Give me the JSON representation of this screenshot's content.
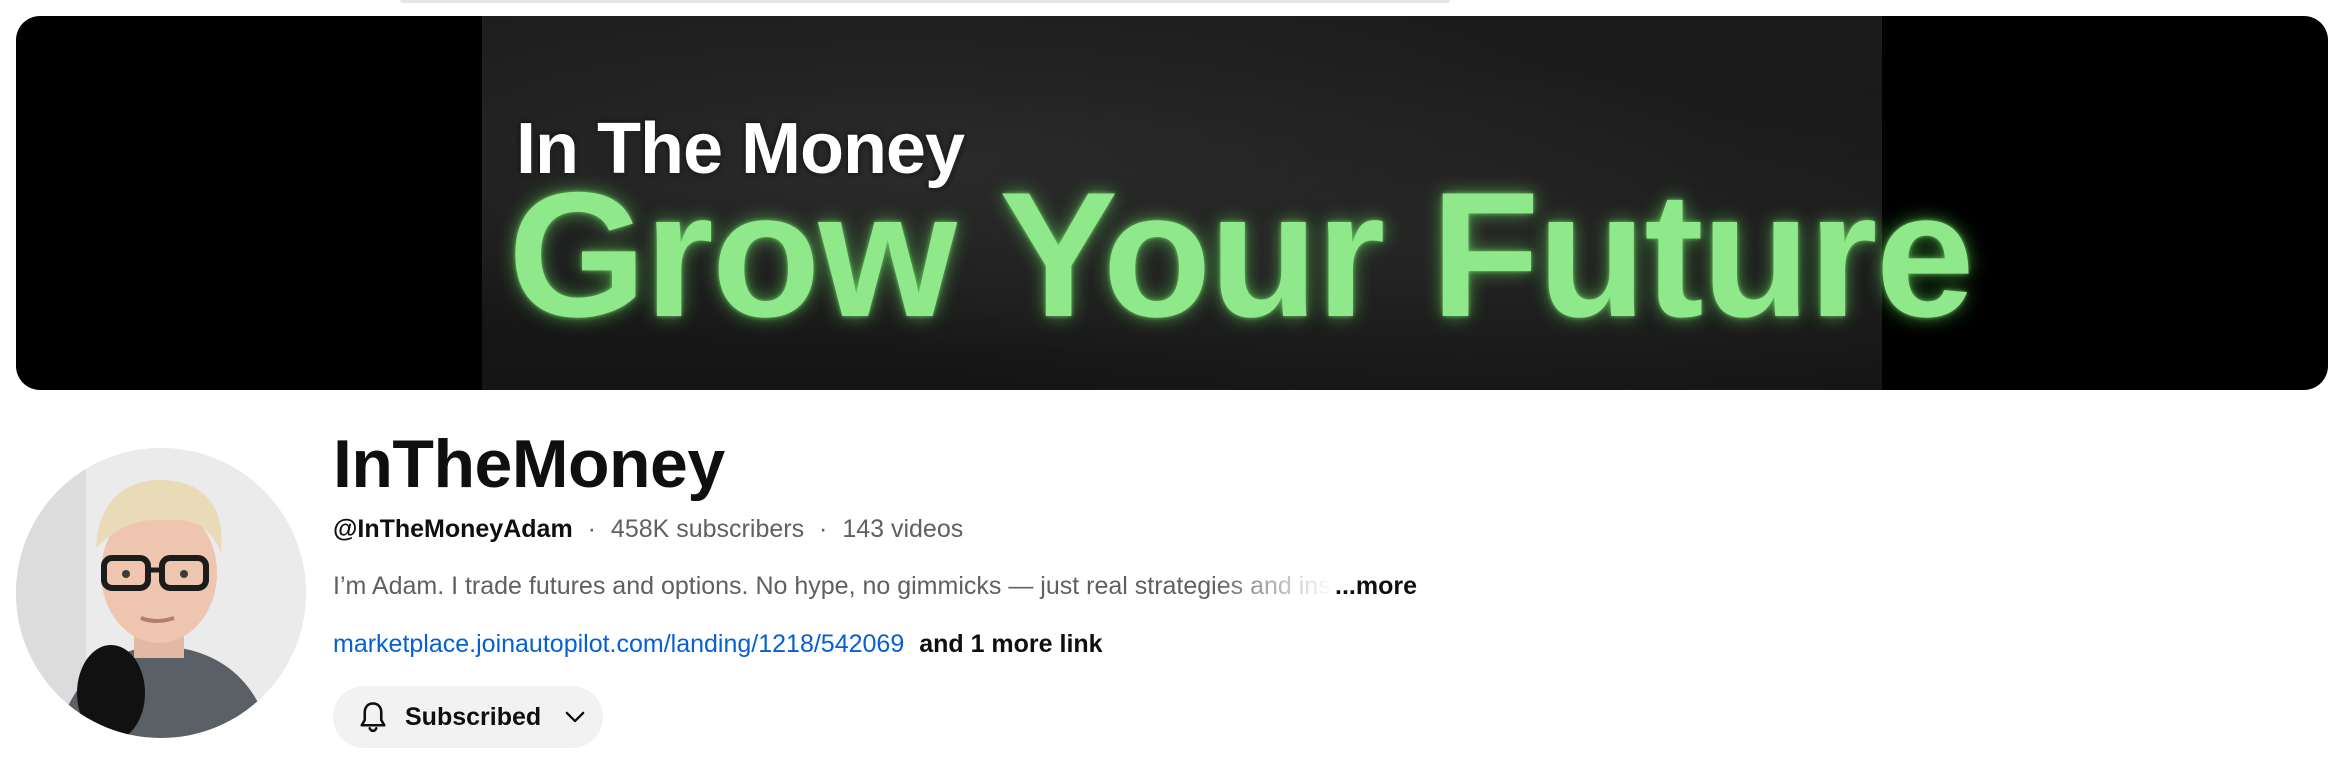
{
  "banner": {
    "headline_small": "In The Money",
    "headline_big": "Grow Your Future"
  },
  "channel": {
    "name": "InTheMoney",
    "handle": "@InTheMoneyAdam",
    "separator": "·",
    "subscribers": "458K subscribers",
    "videos": "143 videos",
    "description": "I’m Adam. I trade futures and options. No hype, no gimmicks — just real strategies and ins",
    "more_label": "...more",
    "link_url": "marketplace.joinautopilot.com/landing/1218/542069",
    "more_links_label": "and 1 more link"
  },
  "subscribe_button": {
    "label": "Subscribed",
    "icon": "bell-icon",
    "dropdown_icon": "chevron-down-icon"
  },
  "colors": {
    "banner_green": "#8fe88a",
    "link_blue": "#065fd4",
    "button_bg": "#f2f2f2",
    "text_secondary": "#606060"
  }
}
